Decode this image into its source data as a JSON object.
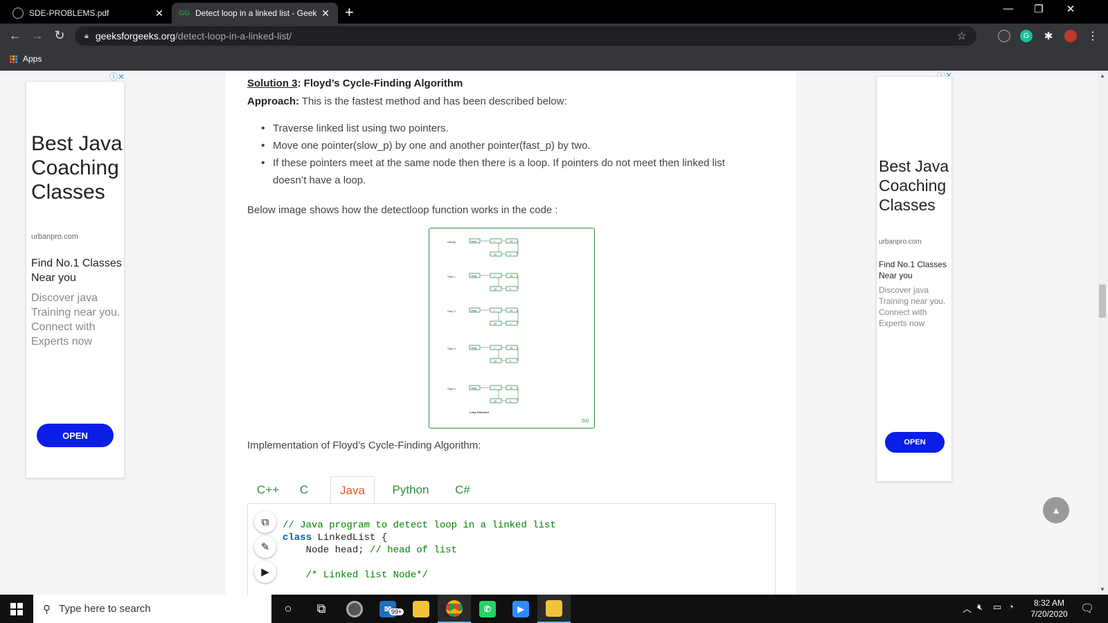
{
  "browser": {
    "tabs": [
      {
        "title": "SDE-PROBLEMS.pdf",
        "close": "✕"
      },
      {
        "title": "Detect loop in a linked list - Geek",
        "close": "✕"
      }
    ],
    "new_tab": "+",
    "window_controls": {
      "minimize": "—",
      "restore": "❐",
      "close": "✕"
    },
    "nav": {
      "back": "←",
      "forward": "→",
      "reload": "↻"
    },
    "url_host": "geeksforgeeks.org",
    "url_path": "/detect-loop-in-a-linked-list/",
    "bookmark_star": "☆",
    "bookmarks": {
      "apps_label": "Apps"
    }
  },
  "ads": {
    "left": {
      "headline": "Best Java Coaching Classes",
      "domain": "urbanpro.com",
      "subhead": "Find No.1 Classes Near you",
      "description": "Discover java Training near you. Connect with Experts now",
      "button": "OPEN",
      "choices": "ⓘ✕"
    },
    "right": {
      "headline": "Best Java Coaching Classes",
      "domain": "urbanpro.com",
      "subhead": "Find No.1 Classes Near you",
      "description": "Discover java Training near you. Connect with Experts now",
      "button": "OPEN",
      "choices": "ⓘ✕"
    }
  },
  "article": {
    "solution_label": "Solution 3",
    "solution_title": ": Floyd’s Cycle-Finding Algorithm",
    "approach_label": "Approach:",
    "approach_text": " This is the fastest method and has been described below:",
    "bullets": [
      "Traverse linked list using two pointers.",
      "Move one pointer(slow_p) by one and another pointer(fast_p) by two.",
      "If these pointers meet at the same node then there is a loop. If pointers do not meet then linked list doesn’t have a loop."
    ],
    "image_intro": "Below image shows how the detectloop function works in the code :",
    "implementation": "Implementation of Floyd’s Cycle-Finding Algorithm:"
  },
  "diagram": {
    "steps": [
      "Initially :",
      "Step 1:",
      "Step 2:",
      "Step 3:",
      "Step 4:"
    ],
    "head_label": "Head",
    "node_values": [
      "1",
      "15",
      "20",
      "4"
    ],
    "footer": "Loop Detected",
    "logo": "GG"
  },
  "language_tabs": [
    "C++",
    "C",
    "Java",
    "Python",
    "C#"
  ],
  "active_language": "Java",
  "code": {
    "lines": [
      {
        "comment": "// Java program to detect loop in a linked list"
      },
      {
        "kw": "class",
        "text": " LinkedList {"
      },
      {
        "text": "    Node head; ",
        "comment": "// head of list"
      },
      {
        "text": ""
      },
      {
        "text": "    ",
        "comment": "/* Linked list Node*/"
      }
    ]
  },
  "code_buttons": {
    "copy": "⧉",
    "edit": "✎",
    "run": "▶"
  },
  "scroll_top": "▲",
  "taskbar": {
    "search_placeholder": "Type here to search",
    "mail_badge": "99+",
    "clock_time": "8:32 AM",
    "clock_date": "7/20/2020"
  },
  "colors": {
    "gfg_green": "#2f8d46",
    "active_tab_orange": "#e65722",
    "ad_button_blue": "#0a1ee8"
  }
}
